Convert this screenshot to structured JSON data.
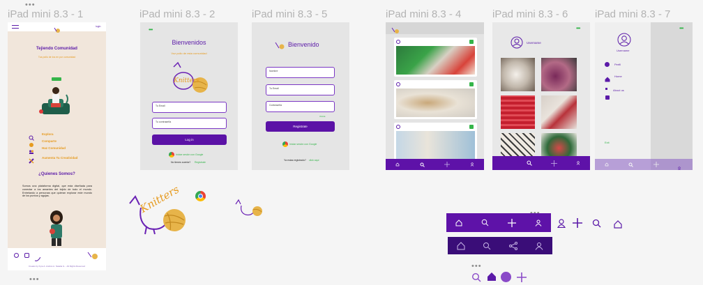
{
  "frames": {
    "f1": "iPad mini 8.3 - 1",
    "f2": "iPad mini 8.3 - 2",
    "f5": "iPad mini 8.3 - 5",
    "f4": "iPad mini 8.3 - 4",
    "f6": "iPad mini 8.3 - 6",
    "f7": "iPad mini 8.3 - 7"
  },
  "landing": {
    "login": "login",
    "title": "Tejiendo Comunidad",
    "subtitle": "Tus pollo de los en por comunidad",
    "features": [
      "Explora",
      "Comparte",
      "Haz Comunidad",
      "Aumenta Tu Creatividad"
    ],
    "about_title": "¿Quienes Somos?",
    "about_text": "Somos una plataforma digital, que esta diseñada para conectar a los amantes del tejido de todo el mundo. Entrelando a personas que quieran explorar este mundo de los puntos y agujas.",
    "footer": "Creado by Kyra A. Andrés A. Natalia G. - All Rights Reserved"
  },
  "login_screen": {
    "title": "Bienvenidos",
    "subtitle": "Voz pollo de esta comunidad",
    "email": "Tu Email",
    "password": "Tu contraseña",
    "button": "Log in",
    "google": "Iniciar sesión con Google",
    "no_account": "No tienes cuenta?",
    "register": "Registrate"
  },
  "register_screen": {
    "title": "Bienvenido",
    "name": "Nombre",
    "email": "Tu Email",
    "password": "Contraseña",
    "small": "Olvidé",
    "button": "Registrate",
    "google": "Iniciar sesión con Google",
    "registered": "Ya estas registrado?",
    "click": "click aqui"
  },
  "profile": {
    "username": "Username"
  },
  "menu": {
    "username": "Username",
    "items": [
      "Perfil",
      "Home",
      "About us"
    ],
    "exit": "Exit"
  },
  "colors": {
    "primary": "#5e12a8",
    "accent": "#e69a1e",
    "green": "#35b54a"
  },
  "icons": [
    "home-icon",
    "search-icon",
    "plus-icon",
    "user-icon",
    "share-icon"
  ]
}
